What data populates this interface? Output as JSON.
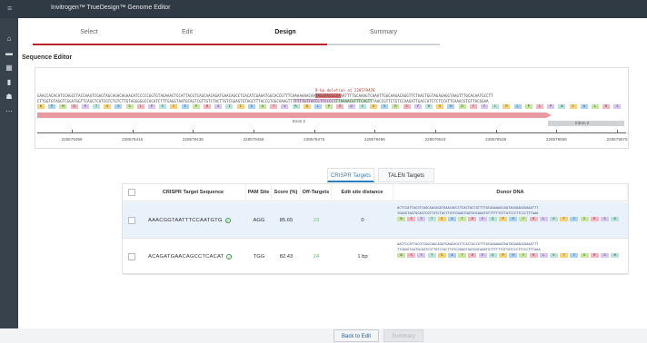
{
  "app": {
    "title": "Invitrogen™ TrueDesign™ Genome Editor"
  },
  "sidebar": {
    "icons": [
      "home-icon",
      "folder-icon",
      "grid-icon",
      "document-icon",
      "users-icon",
      "more-icon"
    ]
  },
  "steps": [
    {
      "label": "Select",
      "state": "done"
    },
    {
      "label": "Edit",
      "state": "done"
    },
    {
      "label": "Design",
      "state": "active"
    },
    {
      "label": "Summary",
      "state": "inactive"
    }
  ],
  "editor": {
    "title": "Sequence Editor",
    "deletion_label": "8-bp deletion at 228579478",
    "seq_top": "GAACCACACATCCAGCCTACCAAGTCGAGTAGCAGACAGAACATCCCCCGGTGTAGAAACTCCATTACGTCAGCAACAGATGAACAGCCTCACATCGAAATGGCACCGTTTCAAAAAAACAATAGGAAGGGGAAATTTTGCAAAGTCAAATTGGCAAGACAGGTTCTAACTGGTAGAGAGGTAAGTTTGCACAATGCCTT",
    "seq_bottom": "CTTGGTGTAGGTCGGATGGTTCAGCTCATCGTCTGTCTTGTAGGGGGCCACATCTTTGAGGTAATGCAGTCGTTGTCTACTTGTCGGAGTGTAGCTTTACCGTGGCAAAGTTTTTTTGTTATCCTTCCCCTTTAAAACGTTTCAGTTTAACCGTTCTGTCCAAGATTGACCATCTCTCCATTCAAACGTGTTACGGAA",
    "amino_acids": [
      "K",
      "P",
      "M",
      "Q",
      "P",
      "T",
      "V",
      "S",
      "S",
      "L",
      "P",
      "E",
      "C",
      "I",
      "P",
      "R",
      "S",
      "I",
      "I",
      "S",
      "A",
      "T",
      "V",
      "R",
      "Q",
      "L",
      "P",
      "E",
      "Q",
      "V",
      "S",
      "V",
      "R",
      "S",
      "P",
      "R",
      "S",
      "R",
      "D",
      "Y",
      "F",
      "L",
      "P",
      "L",
      "P",
      "L",
      "P",
      "N",
      "Y",
      "A",
      "L",
      "R",
      "S"
    ],
    "exon_label": "Exon 2",
    "intron_label": "Intron 2",
    "ruler": [
      "228579396",
      "228579416",
      "228579436",
      "228579456",
      "228579476",
      "228579496",
      "228579516",
      "228579536",
      "228579556",
      "228579576"
    ]
  },
  "targets": {
    "tabs": [
      {
        "label": "CRISPR Targets",
        "active": true
      },
      {
        "label": "TALEN Targets",
        "active": false
      }
    ],
    "columns": [
      "CRISPR Target Sequence",
      "PAM Site",
      "Score (%)",
      "Off-Targets",
      "Edit site distance",
      "Donor DNA"
    ],
    "rows": [
      {
        "sequence": "AAACGGTAATTTCCAATGTG",
        "pam": "AGG",
        "score": "85.65",
        "off_targets": "23",
        "distance": "0",
        "selected": true,
        "donor_top": "ACTCCATTACGTCAGCAACAGATGAACAGCCTCACTACCGTTTTACAAAAAACAATAGGAAGGGAAATTT",
        "donor_bottom": "TGAGGTAATGCAGTCGTTGTCTACTTGTCGGAGTGATGGCAAATGTTTTTTGTTATCCCTTCCCTTTAAA",
        "donor_aa": [
          "N",
          "S",
          "I",
          "T",
          "S",
          "A",
          "T",
          "D",
          "E",
          "Q",
          "P",
          "H",
          "Y",
          "R",
          "L",
          "K",
          "T",
          "I",
          "G",
          "R",
          "G",
          "N"
        ]
      },
      {
        "sequence": "ACAGATGAACAGCCTCACAT",
        "pam": "TGG",
        "score": "82.43",
        "off_targets": "24",
        "distance": "1 bp",
        "selected": false,
        "donor_top": "AACTCCATTACGTCAGCAACAGATGAACAGCCTCACTACCGTTTACAAAAAACAATAGGAAGGGAAATTT",
        "donor_bottom": "TTGAGGTAATGCAGTCGTTGTCTACTTGTCGGAGTGATGGCAAATGTTTTTTGTTATCCCTTCCCTTTAAA",
        "donor_aa": [
          "N",
          "S",
          "I",
          "T",
          "S",
          "A",
          "T",
          "D",
          "E",
          "Q",
          "P",
          "H",
          "Y",
          "R",
          "L",
          "K",
          "T",
          "I",
          "G",
          "R",
          "G",
          "N"
        ]
      }
    ]
  },
  "buttons": {
    "back": "Back to Edit",
    "summary": "Summary"
  },
  "colors": {
    "accent": "#b9242a",
    "link": "#2a7fc1",
    "check": "#3a9d48",
    "exon": "#e99aa0"
  }
}
